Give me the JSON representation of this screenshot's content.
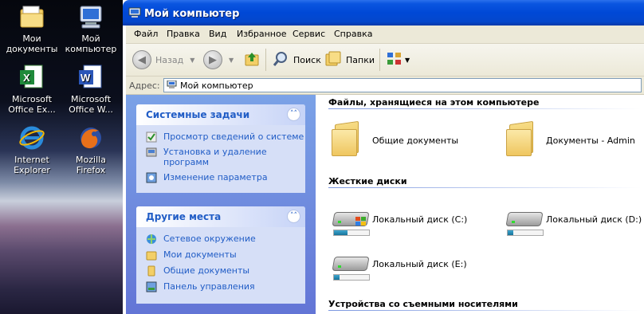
{
  "desktop": {
    "icons": [
      {
        "label": "Мои документы"
      },
      {
        "label": "Мой компьютер"
      },
      {
        "label": "Microsoft Office Ex..."
      },
      {
        "label": "Microsoft Office W..."
      },
      {
        "label": "Internet Explorer"
      },
      {
        "label": "Mozilla Firefox"
      }
    ]
  },
  "window": {
    "title": "Мой компьютер",
    "menu": [
      "Файл",
      "Правка",
      "Вид",
      "Избранное",
      "Сервис",
      "Справка"
    ],
    "toolbar": {
      "back": "Назад",
      "search": "Поиск",
      "folders": "Папки"
    },
    "address": {
      "label": "Адрес:",
      "value": "Мой компьютер"
    }
  },
  "tasks": {
    "system": {
      "title": "Системные задачи",
      "items": [
        "Просмотр сведений о системе",
        "Установка и удаление программ",
        "Изменение параметра"
      ]
    },
    "places": {
      "title": "Другие места",
      "items": [
        "Сетевое окружение",
        "Мои документы",
        "Общие документы",
        "Панель управления"
      ]
    }
  },
  "content": {
    "files_section": "Файлы, хранящиеся на этом компьютере",
    "folders": [
      "Общие документы",
      "Документы - Admin"
    ],
    "drives_section": "Жесткие диски",
    "drives": [
      {
        "name": "Локальный диск (C:)",
        "used": 0.38
      },
      {
        "name": "Локальный диск (D:)",
        "used": 0.15
      },
      {
        "name": "Локальный диск (E:)",
        "used": 0.15
      }
    ],
    "removable_section": "Устройства со съемными носителями"
  }
}
